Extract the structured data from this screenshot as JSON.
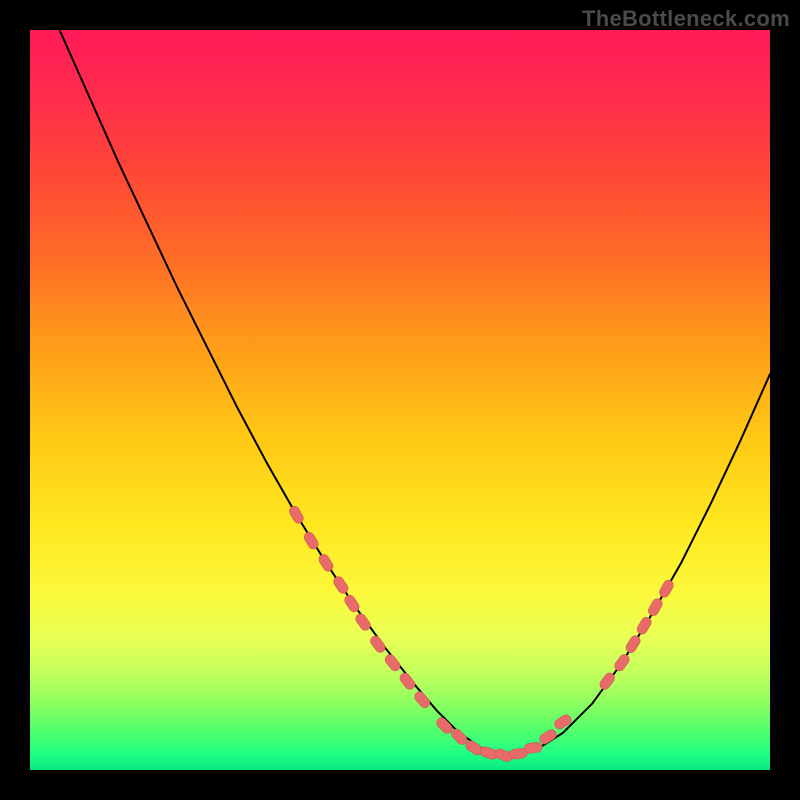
{
  "watermark": "TheBottleneck.com",
  "colors": {
    "page_bg": "#000000",
    "curve_stroke": "#000000",
    "marker_fill": "#e86b6a",
    "marker_stroke": "#c94f4e"
  },
  "chart_data": {
    "type": "line",
    "title": "",
    "xlabel": "",
    "ylabel": "",
    "xlim": [
      0,
      100
    ],
    "ylim": [
      0,
      100
    ],
    "grid": false,
    "legend": false,
    "series": [
      {
        "name": "curve",
        "x": [
          4,
          8,
          12,
          16,
          20,
          24,
          28,
          32,
          36,
          40,
          44,
          48,
          52,
          55,
          58,
          61,
          64,
          68,
          72,
          76,
          80,
          84,
          88,
          92,
          96,
          100
        ],
        "y": [
          100,
          91,
          82,
          73.5,
          65,
          57,
          49,
          41.5,
          34.5,
          28,
          22,
          16.5,
          11.5,
          8,
          5,
          3,
          2,
          2.5,
          5,
          9,
          14.5,
          21,
          28,
          36,
          44.5,
          53.5
        ]
      }
    ],
    "markers": [
      {
        "x": 36,
        "y": 34.5
      },
      {
        "x": 38,
        "y": 31
      },
      {
        "x": 40,
        "y": 28
      },
      {
        "x": 42,
        "y": 25
      },
      {
        "x": 43.5,
        "y": 22.5
      },
      {
        "x": 45,
        "y": 20
      },
      {
        "x": 47,
        "y": 17
      },
      {
        "x": 49,
        "y": 14.5
      },
      {
        "x": 51,
        "y": 12
      },
      {
        "x": 53,
        "y": 9.5
      },
      {
        "x": 56,
        "y": 6
      },
      {
        "x": 58,
        "y": 4.5
      },
      {
        "x": 60,
        "y": 3
      },
      {
        "x": 62,
        "y": 2.3
      },
      {
        "x": 64,
        "y": 2
      },
      {
        "x": 66,
        "y": 2.2
      },
      {
        "x": 68,
        "y": 3
      },
      {
        "x": 70,
        "y": 4.5
      },
      {
        "x": 72,
        "y": 6.5
      },
      {
        "x": 78,
        "y": 12
      },
      {
        "x": 80,
        "y": 14.5
      },
      {
        "x": 81.5,
        "y": 17
      },
      {
        "x": 83,
        "y": 19.5
      },
      {
        "x": 84.5,
        "y": 22
      },
      {
        "x": 86,
        "y": 24.5
      }
    ]
  }
}
